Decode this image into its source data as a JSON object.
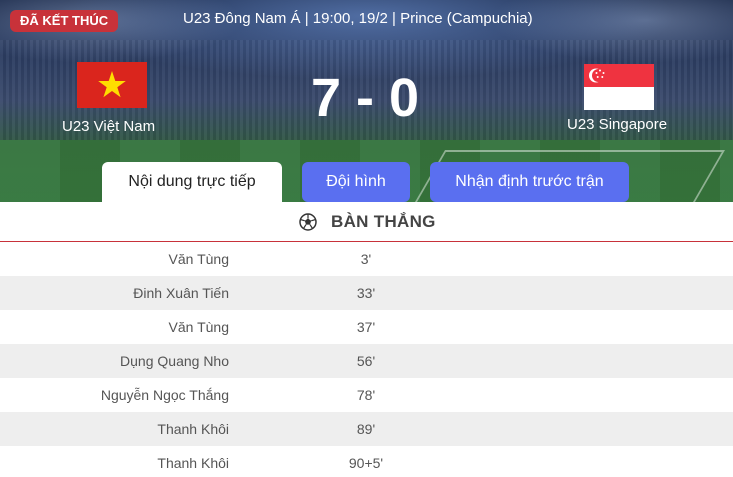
{
  "match": {
    "status": "ĐÃ KẾT THÚC",
    "info": "U23 Đông Nam Á | 19:00, 19/2 | Prince (Campuchia)",
    "home_team": "U23 Việt Nam",
    "away_team": "U23 Singapore",
    "score": "7 - 0",
    "colors": {
      "badge": "#c8323a",
      "tab_active_bg": "#ffffff",
      "tab_bg": "#5a6ff0",
      "divider": "#c8323a"
    }
  },
  "tabs": [
    {
      "label": "Nội dung trực tiếp",
      "active": true
    },
    {
      "label": "Đội hình",
      "active": false
    },
    {
      "label": "Nhận định trước trận",
      "active": false
    }
  ],
  "goals": {
    "title": "BÀN THẮNG",
    "icon": "soccer-ball-icon",
    "rows": [
      {
        "scorer": "Văn Tùng",
        "minute": "3'"
      },
      {
        "scorer": "Đinh Xuân Tiến",
        "minute": "33'"
      },
      {
        "scorer": "Văn Tùng",
        "minute": "37'"
      },
      {
        "scorer": "Dụng Quang Nho",
        "minute": "56'"
      },
      {
        "scorer": "Nguyễn Ngọc Thắng",
        "minute": "78'"
      },
      {
        "scorer": "Thanh Khôi",
        "minute": "89'"
      },
      {
        "scorer": "Thanh Khôi",
        "minute": "90+5'"
      }
    ]
  }
}
